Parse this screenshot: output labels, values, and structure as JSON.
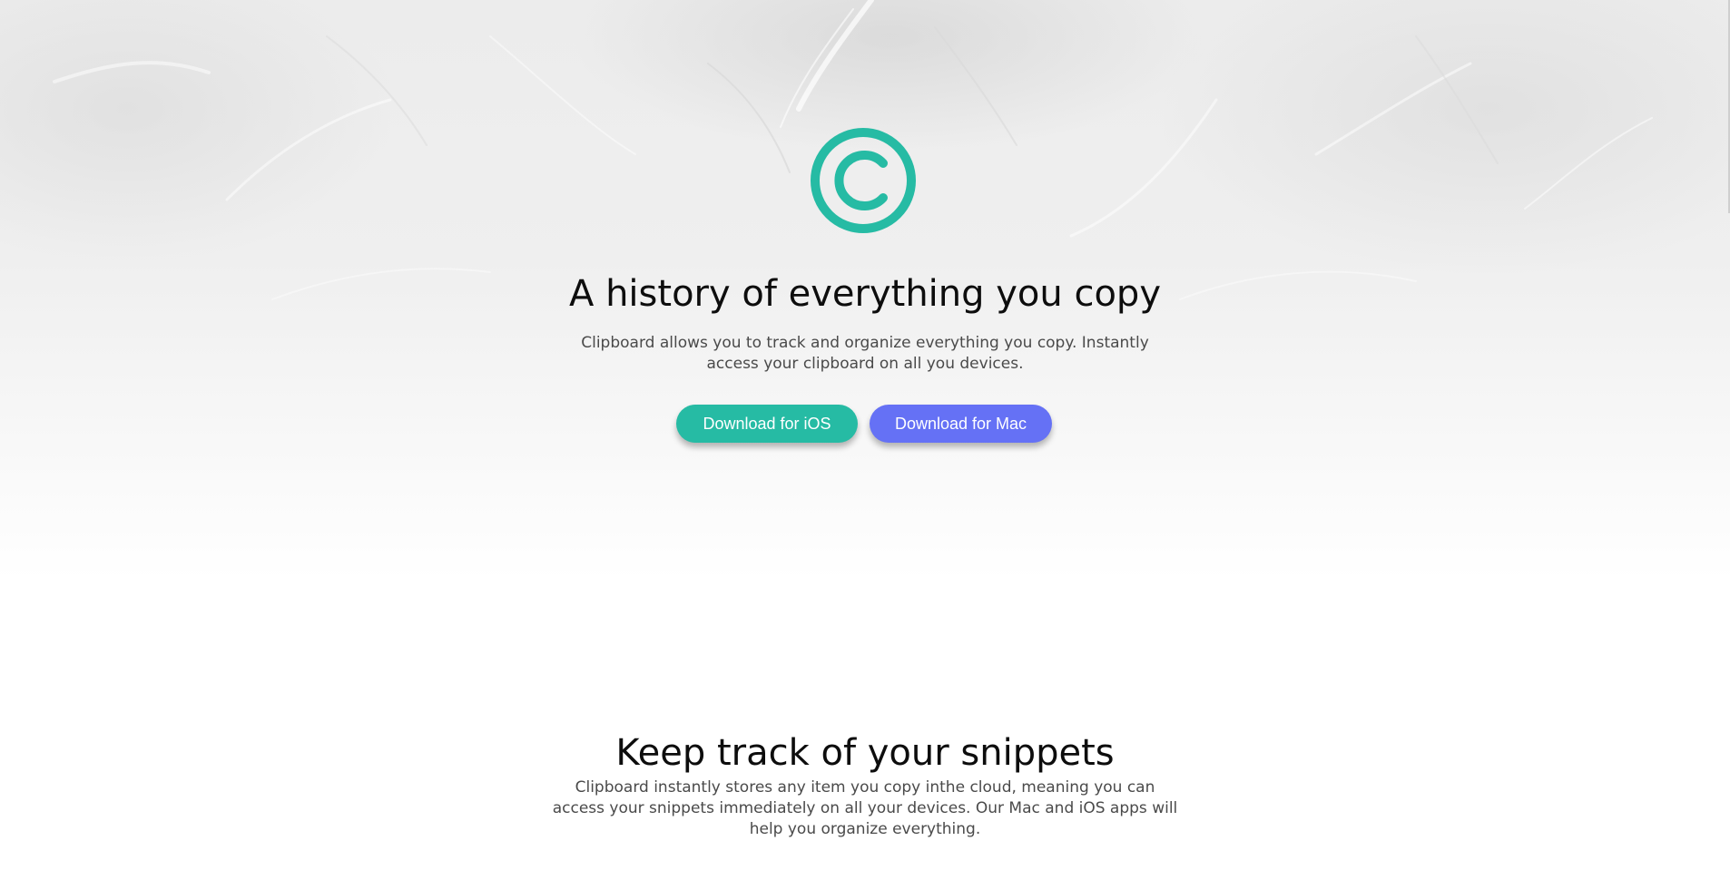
{
  "colors": {
    "accent_ios": "#26bba4",
    "accent_mac": "#6571f5",
    "logo": "#26bba4"
  },
  "hero": {
    "logo_icon": "copyright-icon",
    "title": "A history of everything you copy",
    "description": "Clipboard allows you to track and organize everything you copy. Instantly access your clipboard on all you devices.",
    "buttons": {
      "ios_label": "Download for iOS",
      "mac_label": "Download for Mac"
    }
  },
  "snippets": {
    "title": "Keep track of your snippets",
    "description": "Clipboard instantly stores any item you copy inthe cloud, meaning you can access your snippets immediately on all your devices. Our Mac and iOS apps will help you organize everything."
  }
}
